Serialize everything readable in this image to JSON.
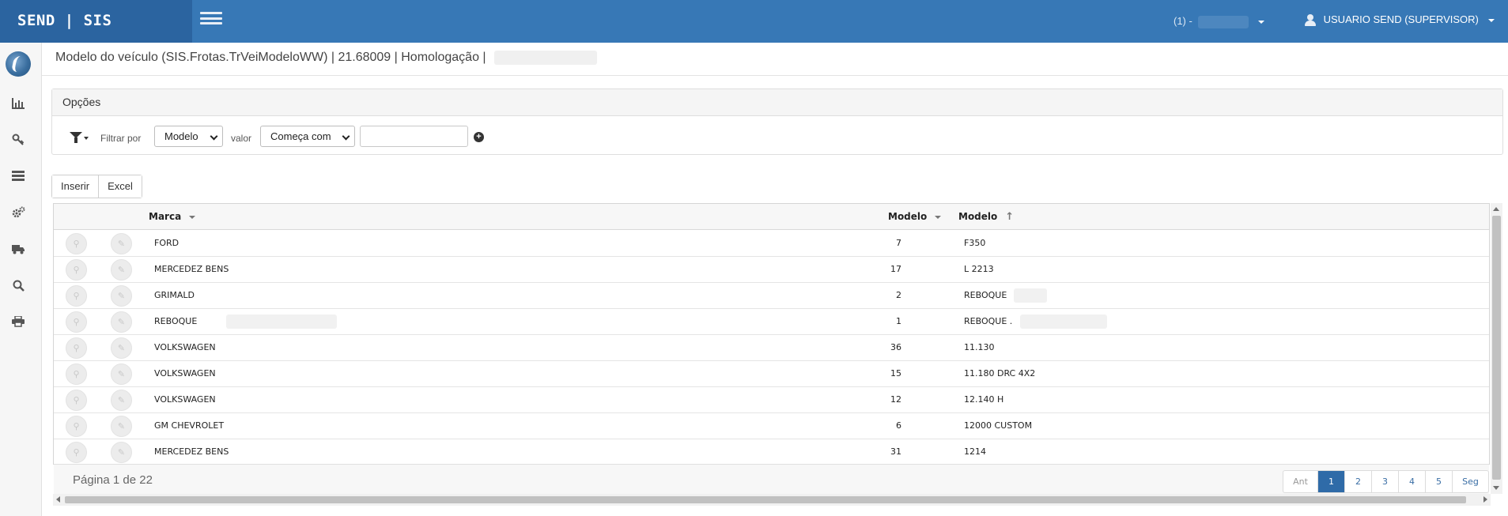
{
  "app": {
    "brand": "SEND | SIS"
  },
  "header": {
    "company_label": "(1) -",
    "user_label": "USUARIO SEND (SUPERVISOR)"
  },
  "sidebar": {
    "icons": [
      "chart-icon",
      "key-icon",
      "list-icon",
      "settings-icon",
      "truck-icon",
      "search-icon",
      "print-icon"
    ]
  },
  "page": {
    "title": "Modelo do veículo (SIS.Frotas.TrVeiModeloWW) | 21.68009 | Homologação |"
  },
  "options": {
    "title": "Opções",
    "filter_by_label": "Filtrar por",
    "filter_field": "Modelo",
    "value_label": "valor",
    "filter_operator": "Começa com",
    "filter_value": ""
  },
  "actions": {
    "insert_label": "Inserir",
    "excel_label": "Excel"
  },
  "grid": {
    "columns": [
      "Marca",
      "Modelo",
      "Modelo"
    ],
    "rows": [
      {
        "marca": "FORD",
        "codigo": "7",
        "modelo": "F350"
      },
      {
        "marca": "MERCEDEZ BENS",
        "codigo": "17",
        "modelo": "L 2213"
      },
      {
        "marca": "GRIMALD",
        "codigo": "2",
        "modelo": "REBOQUE"
      },
      {
        "marca": "REBOQUE",
        "codigo": "1",
        "modelo": "REBOQUE ."
      },
      {
        "marca": "VOLKSWAGEN",
        "codigo": "36",
        "modelo": "11.130"
      },
      {
        "marca": "VOLKSWAGEN",
        "codigo": "15",
        "modelo": "11.180 DRC 4X2"
      },
      {
        "marca": "VOLKSWAGEN",
        "codigo": "12",
        "modelo": "12.140 H"
      },
      {
        "marca": "GM CHEVROLET",
        "codigo": "6",
        "modelo": "12000 CUSTOM"
      },
      {
        "marca": "MERCEDEZ BENS",
        "codigo": "31",
        "modelo": "1214"
      }
    ],
    "page_info": "Página 1 de 22",
    "pager": {
      "prev": "Ant",
      "pages": [
        "1",
        "2",
        "3",
        "4",
        "5"
      ],
      "next": "Seg",
      "current": "1"
    }
  },
  "colors": {
    "topbar": "#3778b6",
    "brand_bg": "#2b64a0",
    "active_page": "#2f6ba8"
  }
}
